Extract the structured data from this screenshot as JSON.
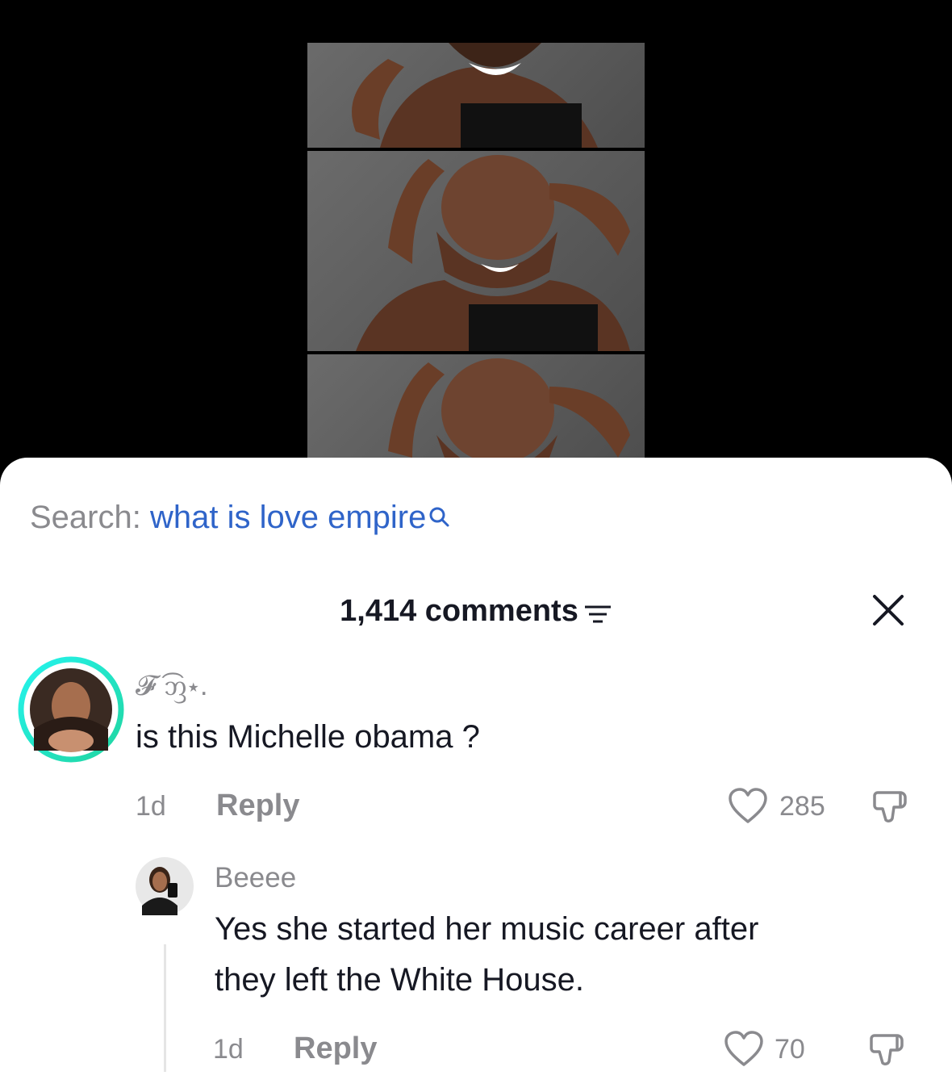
{
  "search": {
    "prefix": "Search: ",
    "query": "what is love empire"
  },
  "header": {
    "comment_count": "1,414 comments"
  },
  "comments": [
    {
      "username": "𝓕 ͡ᦀ⋆.",
      "text": "is this Michelle obama ?",
      "age": "1d",
      "reply_label": "Reply",
      "likes": "285"
    },
    {
      "username": "Beeee",
      "text_line1": "Yes she started her music career after",
      "text_line2": "they left the White House.",
      "age": "1d",
      "reply_label": "Reply",
      "likes": "70"
    }
  ],
  "icons": [
    "search-icon",
    "sort-icon",
    "close-icon",
    "heart-icon",
    "dislike-icon"
  ],
  "colors": {
    "accent_link": "#2f64c9",
    "avatar_ring_start": "#25f4ee",
    "avatar_ring_end": "#20d5a0",
    "secondary_text": "#8a8a8e",
    "primary_text": "#161823"
  }
}
